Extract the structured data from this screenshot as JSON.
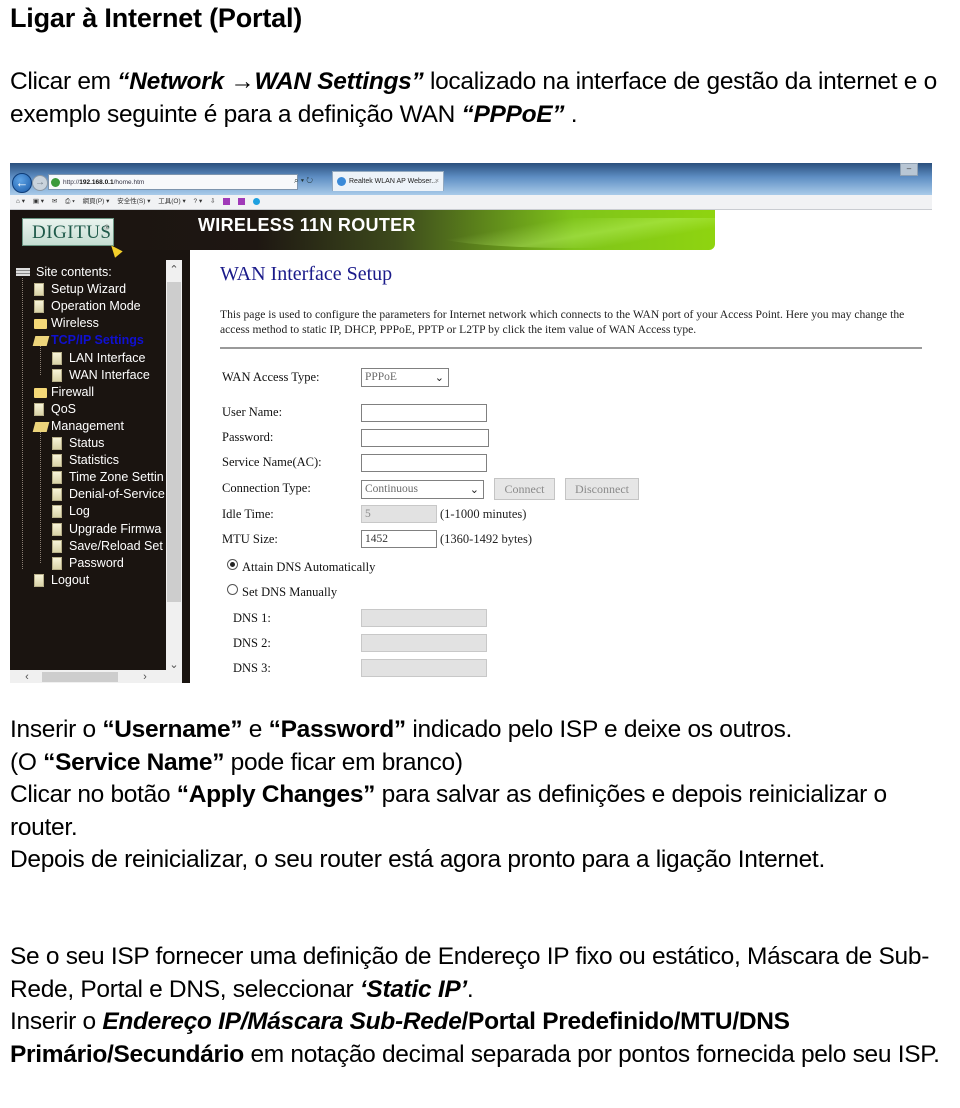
{
  "document": {
    "title": "Ligar à Internet (Portal)",
    "intro": {
      "t1": "Clicar em ",
      "q1": "“Network →WAN Settings”",
      "t2": " localizado na interface de gestão da internet e o exemplo seguinte é para a definição WAN ",
      "q2": "“PPPoE”",
      "t3": " ."
    },
    "instructions": {
      "a1": "Inserir o ",
      "username": "“Username”",
      "a2": " e ",
      "password": "“Password”",
      "a3": " indicado pelo ISP e deixe os outros.",
      "b1": "(O ",
      "service_name": "“Service Name”",
      "b2": " pode ficar em branco)",
      "c1": "Clicar no botão ",
      "apply": "“Apply Changes”",
      "c2": " para salvar as definições e depois reinicializar o router.",
      "d": "Depois de reinicializar, o seu router está agora pronto para a ligação Internet."
    },
    "static_ip": {
      "e1": "Se o seu ISP fornecer uma definição de Endereço IP fixo ou estático, Máscara de Sub-Rede, Portal e DNS, seleccionar ",
      "static": "‘Static IP’",
      "e2": ".",
      "f1": "Inserir o ",
      "fields_italic": "Endereço IP/Máscara Sub-Rede",
      "fields_bold": "/Portal Predefinido/MTU/DNS Primário/Secundário",
      "f2": " em notação decimal separada por pontos fornecida pelo seu ISP."
    }
  },
  "browser": {
    "address_prefix": "http://",
    "address_host": "192.168.0.1",
    "address_path": "/home.htm",
    "search_refresh": "⌕ ▾ ↻",
    "tab_title": "Realtek WLAN AP Webser...",
    "tab_close": "×",
    "back_icon": "←",
    "forward_icon": "→",
    "minimize": "–",
    "toolbar_items": [
      "⌂ ▾",
      "▣ ▾",
      "✉",
      "⎙ ▾",
      "網頁(P) ▾",
      "安全性(S) ▾",
      "工具(O) ▾",
      "? ▾",
      "⇩"
    ]
  },
  "router": {
    "brand": "DIGITUS",
    "brand_mark": "®",
    "title": "WIRELESS 11N ROUTER",
    "sidebar": {
      "root": "Site contents:",
      "items": [
        {
          "label": "Setup Wizard",
          "icon": "page"
        },
        {
          "label": "Operation Mode",
          "icon": "page"
        },
        {
          "label": "Wireless",
          "icon": "folder"
        },
        {
          "label": "TCP/IP Settings",
          "icon": "folder-open",
          "active": true
        },
        {
          "label": "LAN Interface",
          "icon": "page"
        },
        {
          "label": "WAN Interface",
          "icon": "page"
        },
        {
          "label": "Firewall",
          "icon": "folder"
        },
        {
          "label": "QoS",
          "icon": "page"
        },
        {
          "label": "Management",
          "icon": "folder-open"
        },
        {
          "label": "Status",
          "icon": "page"
        },
        {
          "label": "Statistics",
          "icon": "page"
        },
        {
          "label": "Time Zone Settin",
          "icon": "page"
        },
        {
          "label": "Denial-of-Service",
          "icon": "page"
        },
        {
          "label": "Log",
          "icon": "page"
        },
        {
          "label": "Upgrade Firmwa",
          "icon": "page"
        },
        {
          "label": "Save/Reload Set",
          "icon": "page"
        },
        {
          "label": "Password",
          "icon": "page"
        },
        {
          "label": "Logout",
          "icon": "page"
        }
      ],
      "scroll_up": "⌃",
      "scroll_down": "⌄",
      "scroll_left": "‹",
      "scroll_right": "›"
    },
    "page": {
      "heading": "WAN Interface Setup",
      "description": "This page is used to configure the parameters for Internet network which connects to the WAN port of your Access Point. Here you may change the access method to static IP, DHCP, PPPoE, PPTP or L2TP by click the item value of WAN Access type.",
      "wan_access_type_label": "WAN Access Type:",
      "wan_access_type_value": "PPPoE",
      "user_name_label": "User Name:",
      "user_name_value": "",
      "password_label": "Password:",
      "password_value": "",
      "service_name_label": "Service Name(AC):",
      "service_name_value": "",
      "connection_type_label": "Connection Type:",
      "connection_type_value": "Continuous",
      "connect_button": "Connect",
      "disconnect_button": "Disconnect",
      "idle_time_label": "Idle Time:",
      "idle_time_value": "5",
      "idle_time_hint": "(1-1000 minutes)",
      "mtu_label": "MTU Size:",
      "mtu_value": "1452",
      "mtu_hint": "(1360-1492 bytes)",
      "dns_auto_label": "Attain DNS Automatically",
      "dns_auto_selected": true,
      "dns_manual_label": "Set DNS Manually",
      "dns1_label": "DNS 1:",
      "dns1_value": "",
      "dns2_label": "DNS 2:",
      "dns2_value": "",
      "dns3_label": "DNS 3:",
      "dns3_value": "",
      "chevron": "⌄"
    }
  }
}
